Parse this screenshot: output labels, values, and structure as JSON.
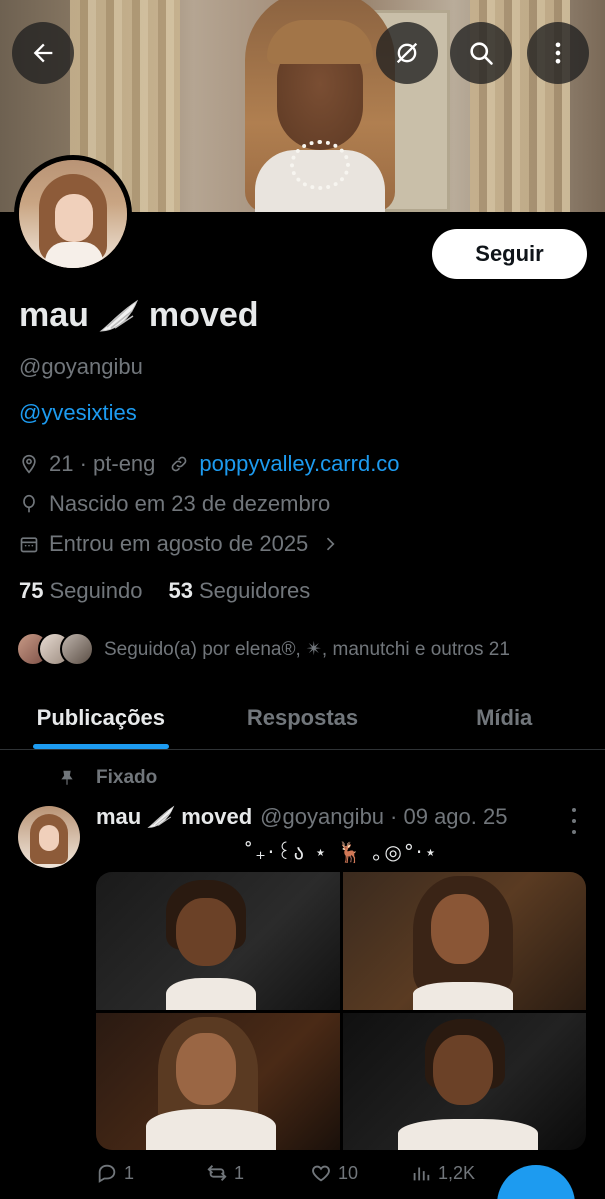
{
  "header": {
    "back_icon": "arrow-left-icon",
    "buttons": [
      "mute-icon",
      "search-icon",
      "more-vertical-icon"
    ]
  },
  "profile": {
    "follow_label": "Seguir",
    "display_name": "mau",
    "display_name_suffix": "moved",
    "handle": "@goyangibu",
    "bio_link": "@yvesixties",
    "location": "21 · pt-eng",
    "website": "poppyvalley.carrd.co",
    "birthday": "Nascido em 23 de dezembro",
    "joined": "Entrou em agosto de 2025",
    "following_count": "75",
    "following_label": "Seguindo",
    "followers_count": "53",
    "followers_label": "Seguidores",
    "followed_by": "Seguido(a) por elena®, ✴︎, manutchi e outros 21"
  },
  "tabs": [
    {
      "label": "Publicações",
      "active": true
    },
    {
      "label": "Respostas",
      "active": false
    },
    {
      "label": "Mídia",
      "active": false
    }
  ],
  "pinned_post": {
    "pinned_label": "Fixado",
    "author": "mau",
    "author_suffix": "moved",
    "handle": "@goyangibu",
    "date": "· 09 ago. 25",
    "text": "˚₊‧꒰ა ⋆ 🦌 ｡◎°‧⋆",
    "replies": "1",
    "reposts": "1",
    "likes": "10",
    "views": "1,2K"
  },
  "colors": {
    "accent": "#1d9bf0",
    "background": "#000000",
    "muted": "#71767b",
    "text": "#e7e9ea"
  }
}
